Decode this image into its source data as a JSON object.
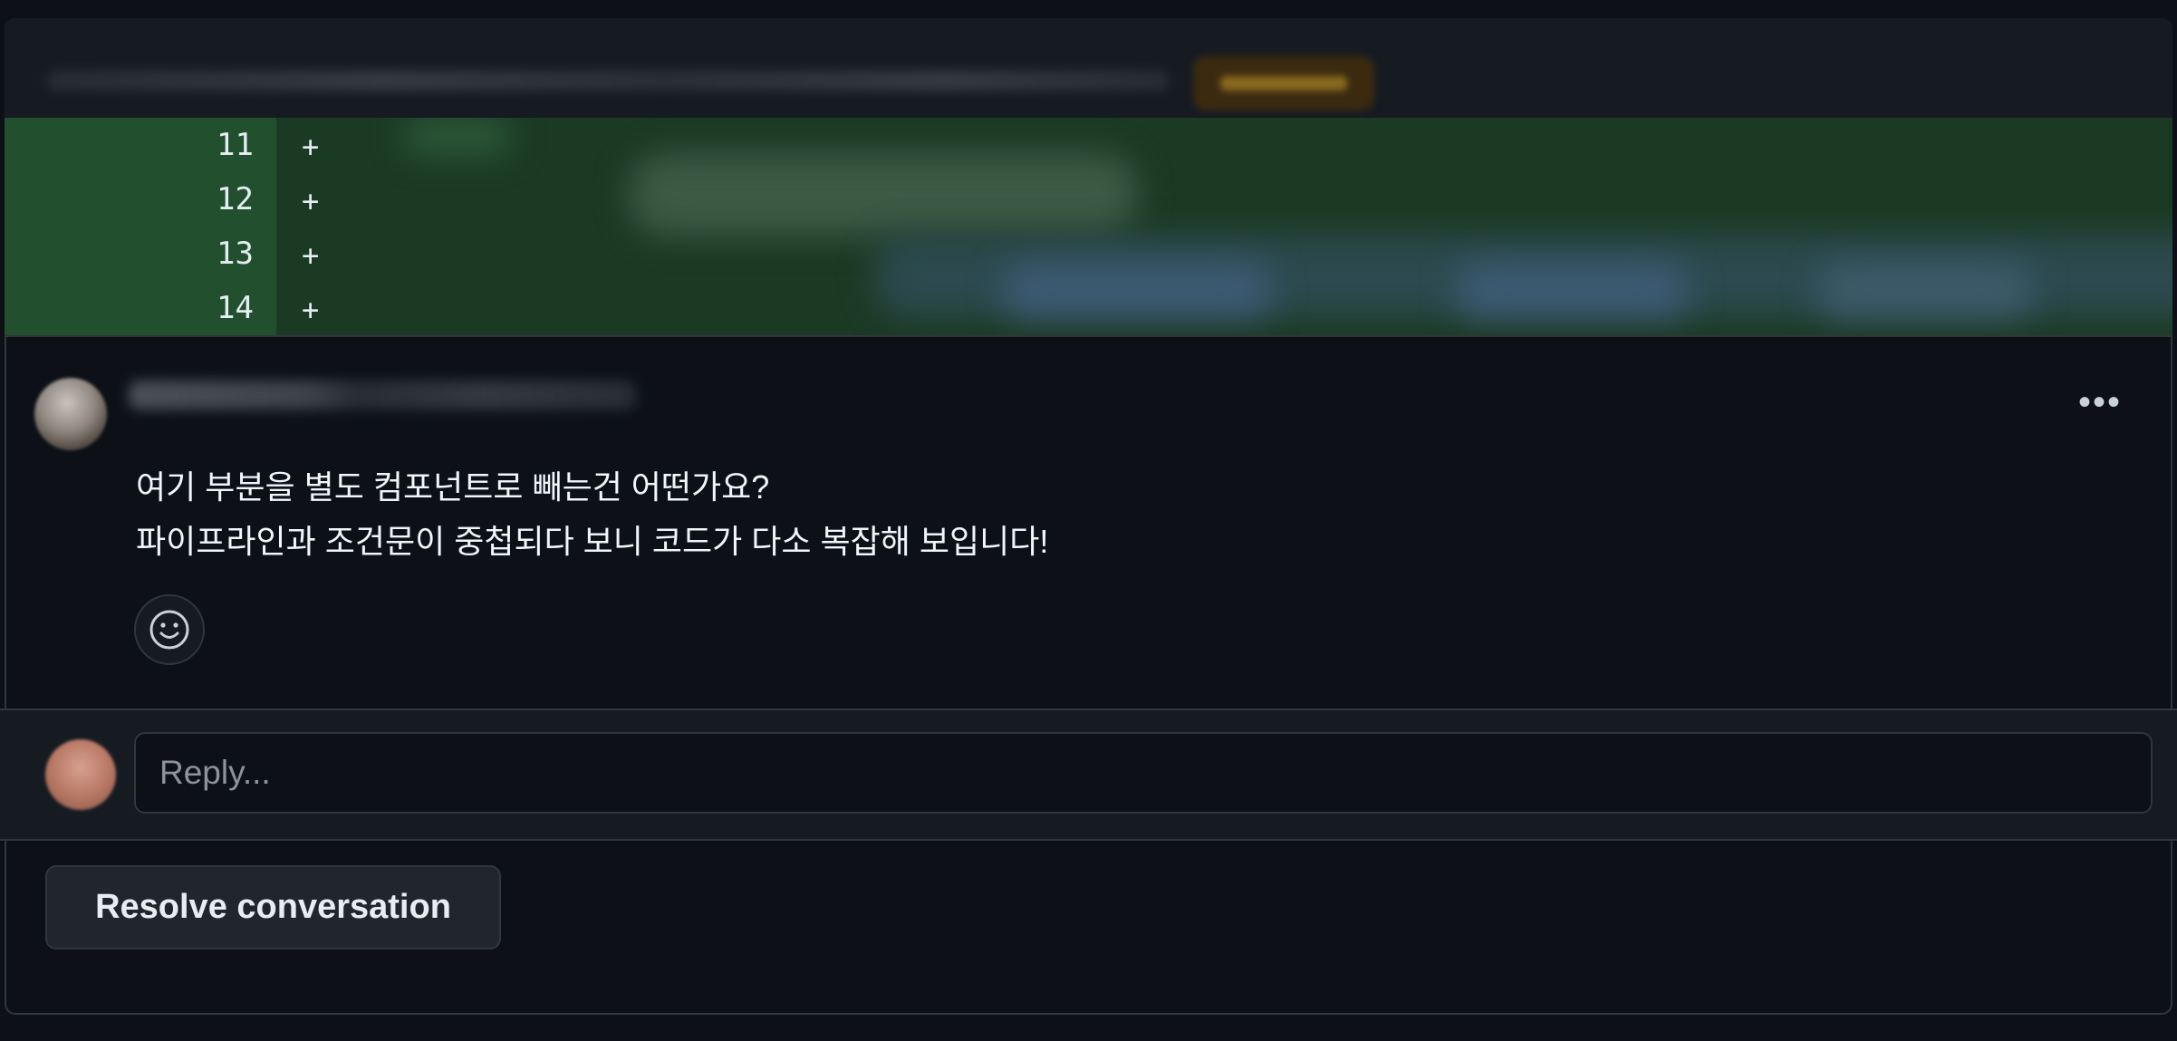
{
  "diff": {
    "lines": [
      {
        "number": "11",
        "sign": "+"
      },
      {
        "number": "12",
        "sign": "+"
      },
      {
        "number": "13",
        "sign": "+"
      },
      {
        "number": "14",
        "sign": "+"
      }
    ]
  },
  "comment": {
    "body_lines": [
      "여기 부분을 별도 컴포넌트로 빼는건 어떤가요?",
      "파이프라인과 조건문이 중첩되다 보니 코드가 다소 복잡해 보입니다!"
    ],
    "menu_label": "•••"
  },
  "reply": {
    "placeholder": "Reply..."
  },
  "actions": {
    "resolve_label": "Resolve conversation"
  },
  "icons": {
    "reaction": "smiley-icon",
    "menu": "kebab-horizontal-icon"
  },
  "colors": {
    "background": "#0d1117",
    "diff_added_bg": "#1b3a24",
    "diff_gutter_bg": "#22502e",
    "border": "#30363d",
    "button_bg": "#21262d"
  }
}
